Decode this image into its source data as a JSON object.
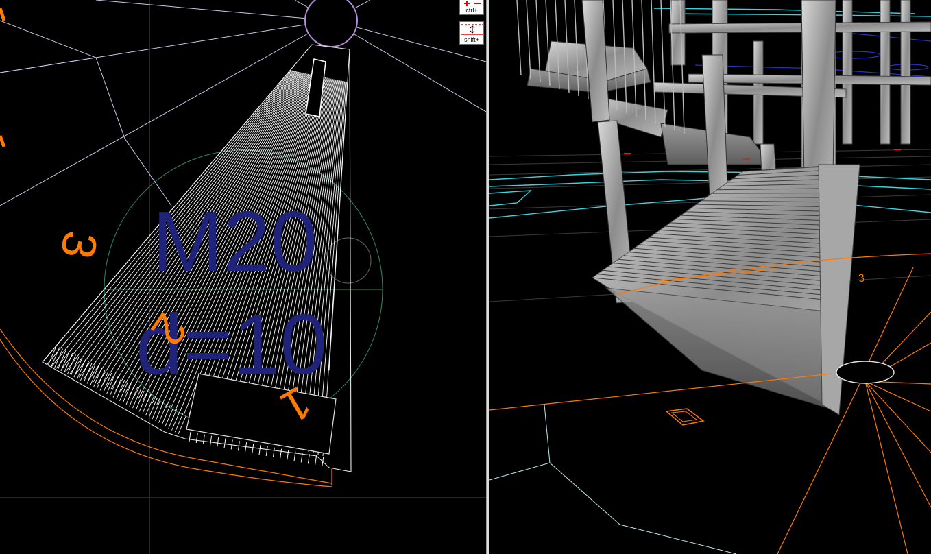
{
  "plan_view": {
    "area_label_line1": "M20",
    "area_label_line2": "d=10",
    "step_numbers": [
      "3",
      "2",
      "1"
    ]
  },
  "toolbar": {
    "ctrl_label": "ctrl+",
    "shift_label": "shift+"
  },
  "view3d": {
    "step_number": "3"
  },
  "colors": {
    "background": "#000000",
    "wire_white": "#ffffff",
    "orange": "#ff7a00",
    "label_blue": "#1f237a",
    "cyan": "#34d6e0",
    "circle_green": "#2f8a6a",
    "guide_gray": "#5a5a5a"
  }
}
